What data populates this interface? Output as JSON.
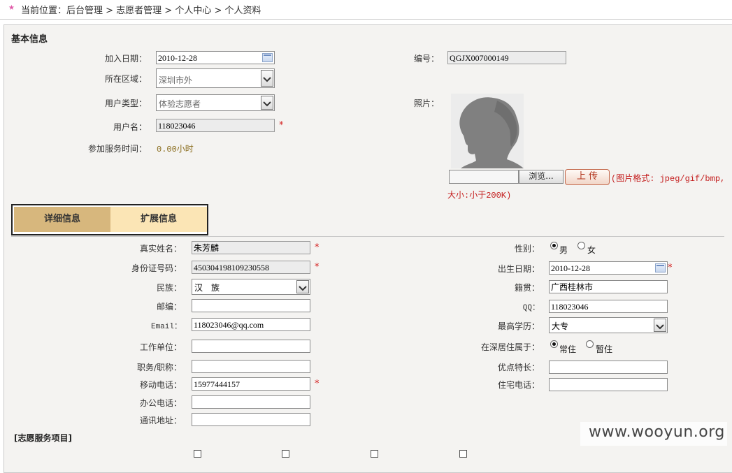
{
  "breadcrumb": {
    "icon": "star-icon",
    "text": "当前位置：后台管理 > 志愿者管理 > 个人中心 > 个人资料"
  },
  "basic": {
    "section_title": "基本信息",
    "join_date_label": "加入日期：",
    "join_date": "2010-12-28",
    "serial_label": "编号：",
    "serial": "QGJX007000149",
    "district_label": "所在区域：",
    "district": "深圳市外",
    "usertype_label": "用户类型：",
    "usertype": "体验志愿者",
    "photo_label": "照片：",
    "username_label": "用户名：",
    "username": "118023046",
    "service_time_label": "参加服务时间：",
    "service_time": "0.00小时",
    "browse_button": "浏览...",
    "upload_button": "上 传",
    "upload_hint": "(图片格式: jpeg/gif/bmp,大小:小于200K)"
  },
  "tabs": {
    "detail": "详细信息",
    "extended": "扩展信息"
  },
  "detail": {
    "realname_label": "真实姓名：",
    "realname": "朱芳麟",
    "gender_label": "性别：",
    "gender_male": "男",
    "gender_female": "女",
    "idcard_label": "身份证号码：",
    "idcard": "450304198109230558",
    "birth_label": "出生日期：",
    "birth": "2010-12-28",
    "ethnic_label": "民族：",
    "ethnic": "汉　族",
    "native_label": "籍贯：",
    "native": "广西桂林市",
    "zip_label": "邮编：",
    "zip": "",
    "qq_label": "QQ：",
    "qq": "118023046",
    "email_label": "Email：",
    "email": "118023046@qq.com",
    "edu_label": "最高学历：",
    "edu": "大专",
    "employer_label": "工作单位：",
    "employer": "",
    "residence_label": "在深居住属于：",
    "residence_permanent": "常住",
    "residence_temp": "暂住",
    "title_label": "职务/职称：",
    "title": "",
    "strength_label": "优点特长：",
    "strength": "",
    "mobile_label": "移动电话：",
    "mobile": "15977444157",
    "homephone_label": "住宅电话：",
    "homephone": "",
    "officephone_label": "办公电话：",
    "officephone": "",
    "address_label": "通讯地址：",
    "address": ""
  },
  "service_section_title": "[志愿服务项目]",
  "watermark": "www.wooyun.org",
  "required_mark": "*"
}
